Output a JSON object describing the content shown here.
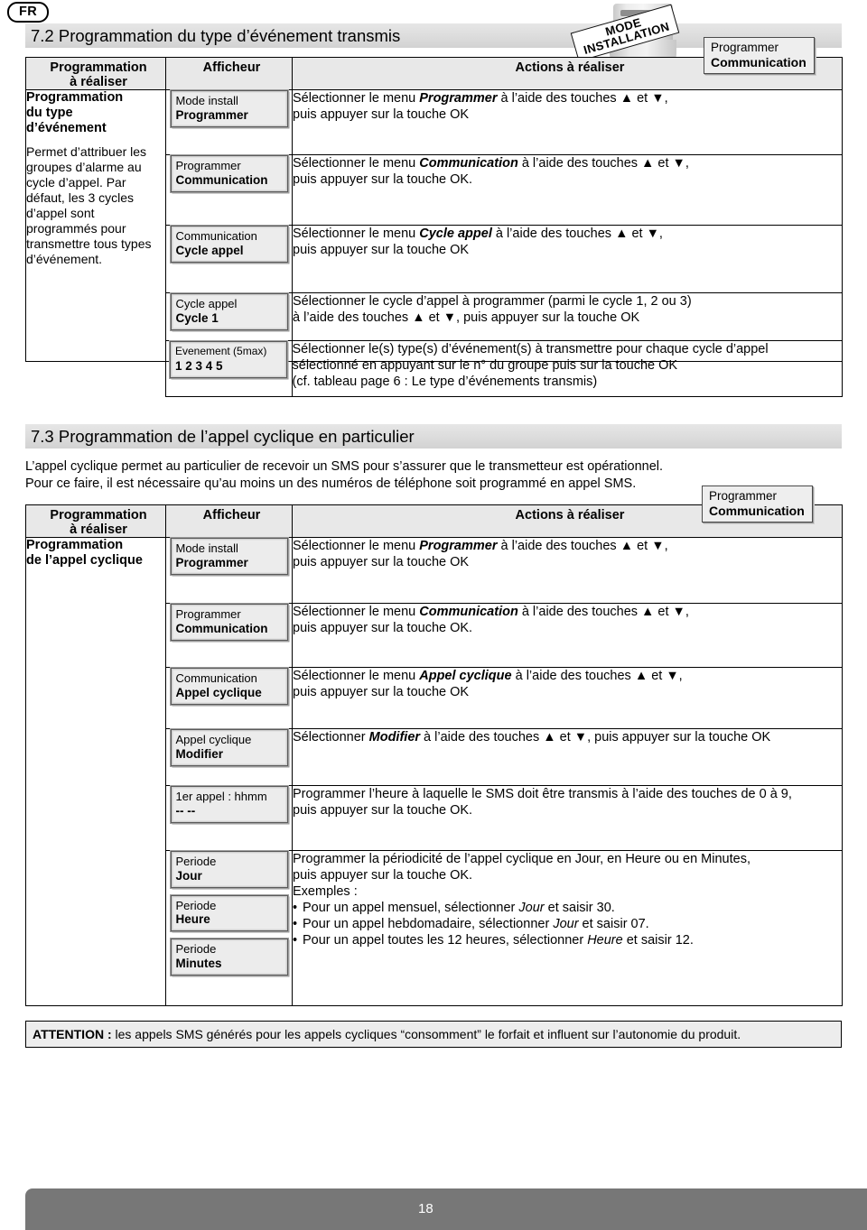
{
  "language_badge": "FR",
  "stamp": {
    "line1": "MODE",
    "line2": "INSTALLATION"
  },
  "callouts": {
    "top": {
      "line1": "Programmer",
      "line2": "Communication"
    },
    "mid": {
      "line1": "Programmer",
      "line2": "Communication"
    }
  },
  "section_72": {
    "title": "7.2 Programmation du type d’événement transmis",
    "table": {
      "headers": {
        "col1_line1": "Programmation",
        "col1_line2": "à réaliser",
        "col2": "Afficheur",
        "col3": "Actions à réaliser"
      },
      "left_cell": {
        "title_line1": "Programmation",
        "title_line2": "du type",
        "title_line3": "d’événement",
        "body": "Permet d’attribuer les groupes d’alarme au cycle d’appel. Par défaut, les 3 cycles d’appel sont programmés pour transmettre tous types d’événement."
      },
      "rows": [
        {
          "display": {
            "line1": "Mode install",
            "line2": "Programmer"
          },
          "action_line1_pre": "Sélectionner le menu ",
          "action_line1_em": "Programmer",
          "action_line1_post": " à l’aide des touches ▲ et ▼,",
          "action_line2": "puis appuyer sur la touche OK"
        },
        {
          "display": {
            "line1": "Programmer",
            "line2": "Communication"
          },
          "action_line1_pre": "Sélectionner le menu ",
          "action_line1_em": "Communication",
          "action_line1_post": " à l’aide des touches ▲ et ▼,",
          "action_line2": "puis appuyer sur la touche OK."
        },
        {
          "display": {
            "line1": "Communication",
            "line2": "Cycle appel"
          },
          "action_line1_pre": "Sélectionner le menu ",
          "action_line1_em": "Cycle appel",
          "action_line1_post": " à l’aide des touches ▲ et ▼,",
          "action_line2": "puis appuyer sur la touche OK"
        },
        {
          "display": {
            "line1": "Cycle appel",
            "line2": "Cycle 1"
          },
          "action_line1_pre": "Sélectionner le cycle d’appel à programmer (parmi le cycle 1, 2 ou 3)",
          "action_line1_em": "",
          "action_line1_post": "",
          "action_line2": "à l’aide des touches ▲ et ▼, puis appuyer sur la touche OK"
        }
      ],
      "last_row": {
        "display": {
          "line1": "Evenement (5max)",
          "line2": "1 2 3 4 5"
        },
        "action_line1": "Sélectionner le(s) type(s) d’événement(s) à transmettre pour chaque cycle d’appel",
        "action_line2": "sélectionné en appuyant sur le n° du groupe puis sur la touche OK",
        "action_line3": "(cf. tableau page 6 : Le type d’événements transmis)"
      }
    }
  },
  "section_73": {
    "title": "7.3 Programmation de l’appel cyclique en particulier",
    "intro_line1": "L’appel cyclique permet au particulier de recevoir un SMS pour s’assurer que le transmetteur est opérationnel.",
    "intro_line2": "Pour ce faire, il est nécessaire qu’au moins un des numéros de téléphone soit programmé en appel SMS.",
    "table": {
      "headers": {
        "col1_line1": "Programmation",
        "col1_line2": "à réaliser",
        "col2": "Afficheur",
        "col3": "Actions à réaliser"
      },
      "left_cell": {
        "title_line1": "Programmation",
        "title_line2": "de l’appel cyclique"
      },
      "rows": [
        {
          "display": {
            "line1": "Mode install",
            "line2": "Programmer"
          },
          "action_line1_pre": "Sélectionner le menu ",
          "action_line1_em": "Programmer",
          "action_line1_post": " à l’aide des touches ▲ et ▼,",
          "action_line2": "puis appuyer sur la touche OK"
        },
        {
          "display": {
            "line1": "Programmer",
            "line2": "Communication"
          },
          "action_line1_pre": "Sélectionner le menu ",
          "action_line1_em": "Communication",
          "action_line1_post": " à l’aide des touches ▲ et ▼,",
          "action_line2": "puis appuyer sur la touche OK."
        },
        {
          "display": {
            "line1": "Communication",
            "line2": "Appel cyclique"
          },
          "action_line1_pre": "Sélectionner le menu ",
          "action_line1_em": "Appel cyclique",
          "action_line1_post": " à l’aide des touches ▲ et ▼,",
          "action_line2": "puis appuyer sur la touche OK"
        },
        {
          "display": {
            "line1": "Appel cyclique",
            "line2": "Modifier"
          },
          "action_line1_pre": "Sélectionner ",
          "action_line1_em": "Modifier",
          "action_line1_post": " à l’aide des touches ▲ et ▼, puis appuyer sur la touche OK",
          "action_line2": ""
        },
        {
          "display": {
            "line1": "1er appel : hhmm",
            "line2": "-- --"
          },
          "action_line1_pre": "Programmer l’heure à laquelle le SMS doit être transmis à l’aide des touches de 0 à 9,",
          "action_line1_em": "",
          "action_line1_post": "",
          "action_line2": "puis appuyer sur la touche OK."
        }
      ],
      "period_row": {
        "displays": [
          {
            "line1": "Periode",
            "line2": "Jour"
          },
          {
            "line1": "Periode",
            "line2": "Heure"
          },
          {
            "line1": "Periode",
            "line2": "Minutes"
          }
        ],
        "action_line1": "Programmer la périodicité de l’appel cyclique en Jour, en Heure ou en Minutes,",
        "action_line2": "puis appuyer sur la touche OK.",
        "action_line3": "Exemples :",
        "bullets": [
          {
            "pre": "Pour un appel mensuel, sélectionner ",
            "em": "Jour",
            "post": " et saisir 30."
          },
          {
            "pre": "Pour un appel hebdomadaire, sélectionner ",
            "em": "Jour",
            "post": " et saisir 07."
          },
          {
            "pre": "Pour un appel toutes les 12 heures, sélectionner ",
            "em": "Heure",
            "post": " et saisir 12."
          }
        ]
      }
    }
  },
  "attention": {
    "label": "ATTENTION :",
    "text": " les appels SMS générés pour les appels cycliques “consomment” le forfait et influent sur l’autonomie du produit."
  },
  "footer": {
    "page_number": "18"
  }
}
